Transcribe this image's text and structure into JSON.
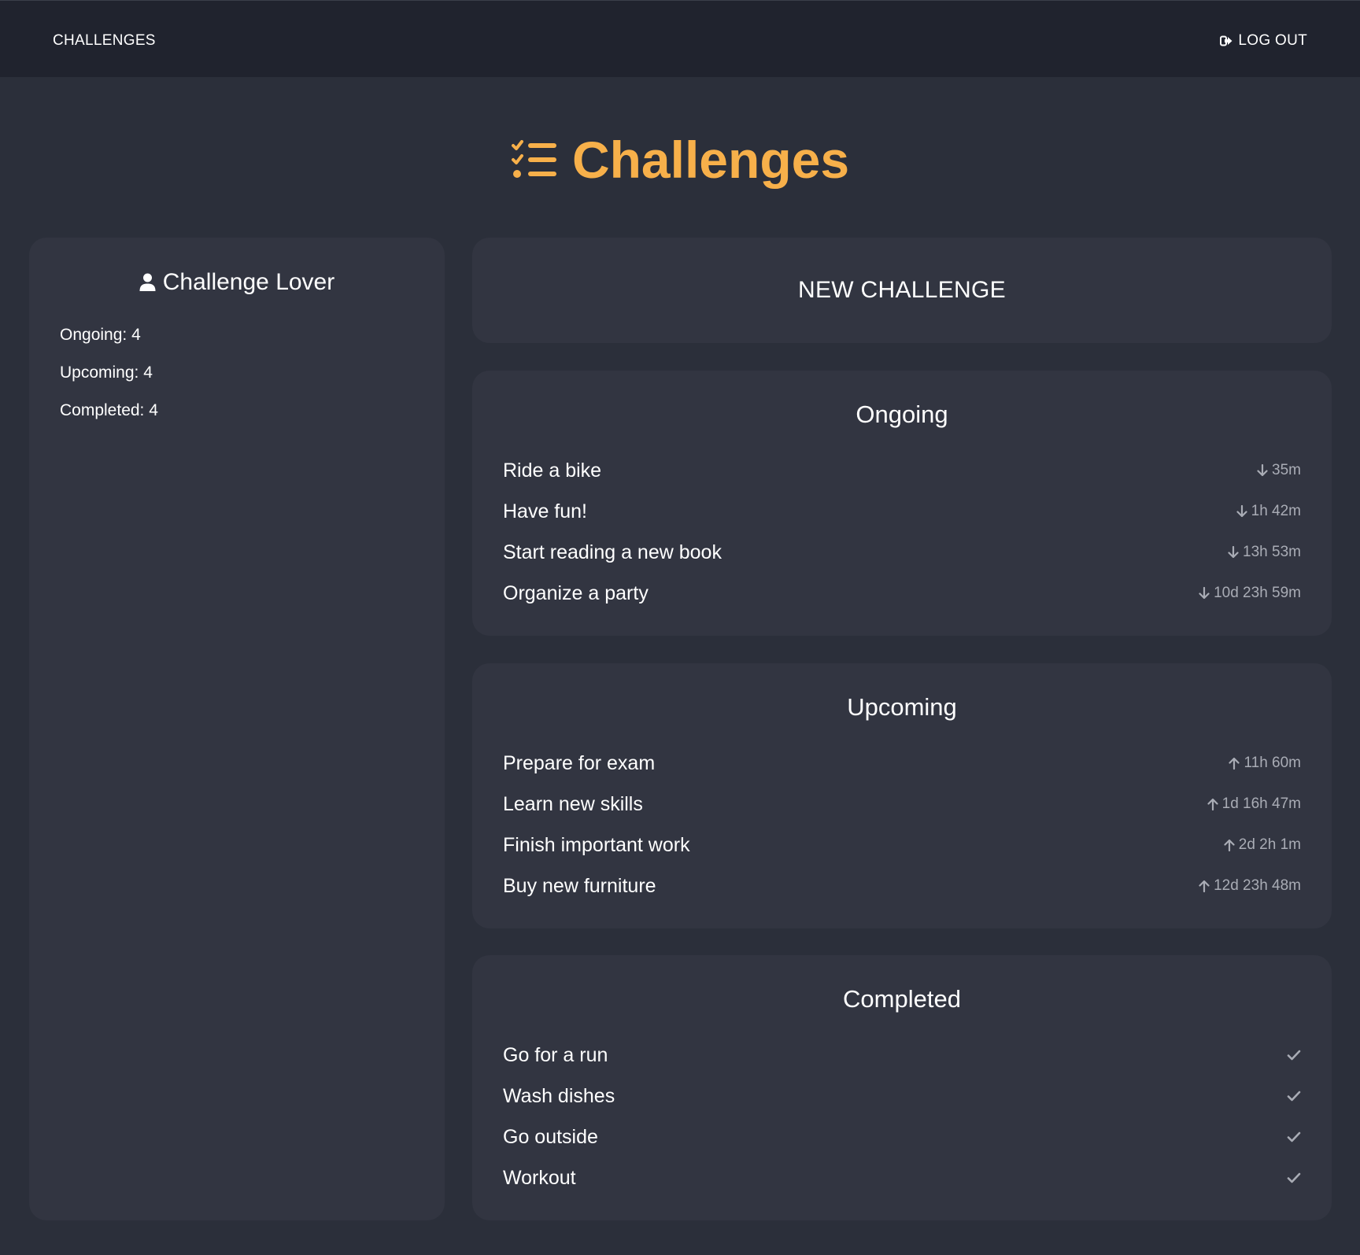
{
  "navbar": {
    "brand": "CHALLENGES",
    "logout_label": "LOG OUT"
  },
  "header": {
    "title": "Challenges",
    "icon": "list-check-icon",
    "accent_color": "#f7b04a"
  },
  "profile": {
    "name": "Challenge Lover",
    "icon": "user-icon",
    "stats": {
      "ongoing": "Ongoing: 4",
      "upcoming": "Upcoming: 4",
      "completed": "Completed: 4"
    }
  },
  "new_challenge": {
    "label": "NEW CHALLENGE"
  },
  "sections": {
    "ongoing": {
      "title": "Ongoing",
      "icon": "arrow-down-icon",
      "items": [
        {
          "label": "Ride a bike",
          "time": "35m"
        },
        {
          "label": "Have fun!",
          "time": "1h 42m"
        },
        {
          "label": "Start reading a new book",
          "time": "13h 53m"
        },
        {
          "label": "Organize a party",
          "time": "10d 23h 59m"
        }
      ]
    },
    "upcoming": {
      "title": "Upcoming",
      "icon": "arrow-up-icon",
      "items": [
        {
          "label": "Prepare for exam",
          "time": "11h 60m"
        },
        {
          "label": "Learn new skills",
          "time": "1d 16h 47m"
        },
        {
          "label": "Finish important work",
          "time": "2d 2h 1m"
        },
        {
          "label": "Buy new furniture",
          "time": "12d 23h 48m"
        }
      ]
    },
    "completed": {
      "title": "Completed",
      "icon": "check-icon",
      "items": [
        {
          "label": "Go for a run"
        },
        {
          "label": "Wash dishes"
        },
        {
          "label": "Go outside"
        },
        {
          "label": "Workout"
        }
      ]
    }
  }
}
